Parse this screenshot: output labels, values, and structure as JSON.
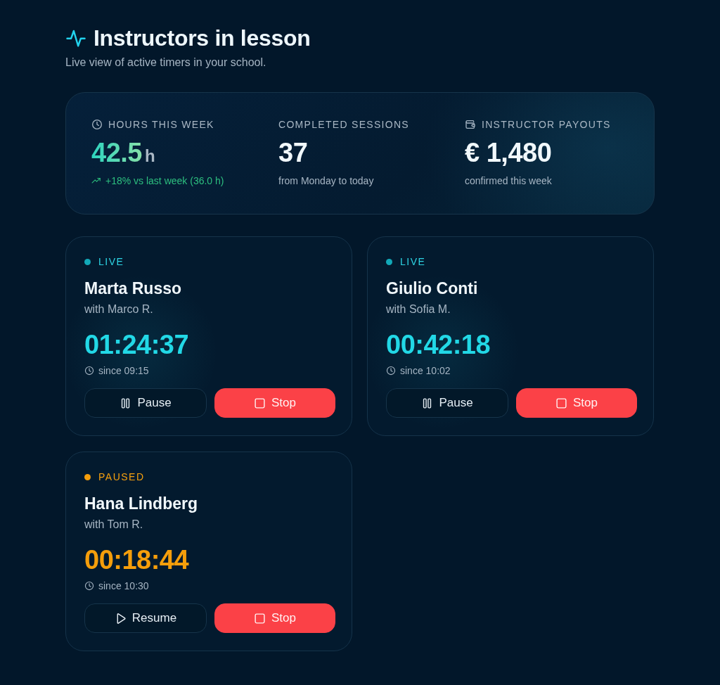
{
  "header": {
    "title": "Instructors in lesson",
    "subtitle": "Live view of active timers in your school."
  },
  "stats": [
    {
      "kind": "hours",
      "label": "HOURS THIS WEEK",
      "value": "42.5",
      "unit": "h",
      "note": "+18% vs last week (36.0 h)"
    },
    {
      "kind": "count",
      "label": "COMPLETED SESSIONS",
      "value": "37",
      "note": "from Monday to today"
    },
    {
      "kind": "money",
      "label": "INSTRUCTOR PAYOUTS",
      "value": "€ 1,480",
      "note": "confirmed this week"
    }
  ],
  "timers": [
    {
      "kind": "live",
      "status": "LIVE",
      "color": "#12a9b8",
      "name": "Marta Russo",
      "student": "with Marco R.",
      "elapsed": "01:24:37",
      "since": "since 09:15",
      "actions": [
        {
          "kind": "pause",
          "label": "Pause"
        },
        {
          "kind": "stop",
          "label": "Stop"
        }
      ]
    },
    {
      "kind": "live",
      "status": "LIVE",
      "color": "#12a9b8",
      "name": "Giulio Conti",
      "student": "with Sofia M.",
      "elapsed": "00:42:18",
      "since": "since 10:02",
      "actions": [
        {
          "kind": "pause",
          "label": "Pause"
        },
        {
          "kind": "stop",
          "label": "Stop"
        }
      ]
    },
    {
      "kind": "paused",
      "status": "PAUSED",
      "color": "#f59e0b",
      "name": "Hana Lindberg",
      "student": "with Tom R.",
      "elapsed": "00:18:44",
      "since": "since 10:30",
      "actions": [
        {
          "kind": "resume",
          "label": "Resume"
        },
        {
          "kind": "stop",
          "label": "Stop"
        }
      ]
    }
  ]
}
